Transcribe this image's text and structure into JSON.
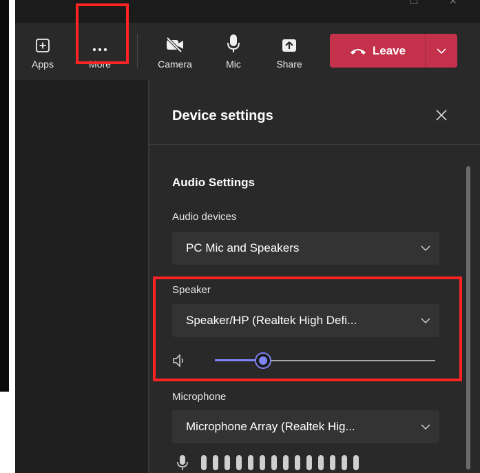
{
  "toolbar": {
    "apps_label": "Apps",
    "more_label": "More",
    "camera_label": "Camera",
    "mic_label": "Mic",
    "share_label": "Share",
    "leave_label": "Leave"
  },
  "panel": {
    "title": "Device settings",
    "section_title": "Audio Settings",
    "audio_devices_label": "Audio devices",
    "audio_devices_value": "PC Mic and Speakers",
    "speaker_label": "Speaker",
    "speaker_value": "Speaker/HP (Realtek High Defi...",
    "speaker_volume_percent": 22,
    "microphone_label": "Microphone",
    "microphone_value": "Microphone Array (Realtek Hig...",
    "mic_meter_segments": 14
  },
  "colors": {
    "leave_red": "#c4314b",
    "accent": "#7f85f5",
    "highlight": "#ff2424"
  },
  "icons": {
    "apps": "plus-square-icon",
    "more": "ellipsis-icon",
    "camera": "camera-off-icon",
    "mic": "microphone-icon",
    "share": "share-up-arrow-icon",
    "leave": "phone-hangup-icon",
    "close": "close-icon",
    "chevron": "chevron-down-icon",
    "speaker": "speaker-icon"
  }
}
